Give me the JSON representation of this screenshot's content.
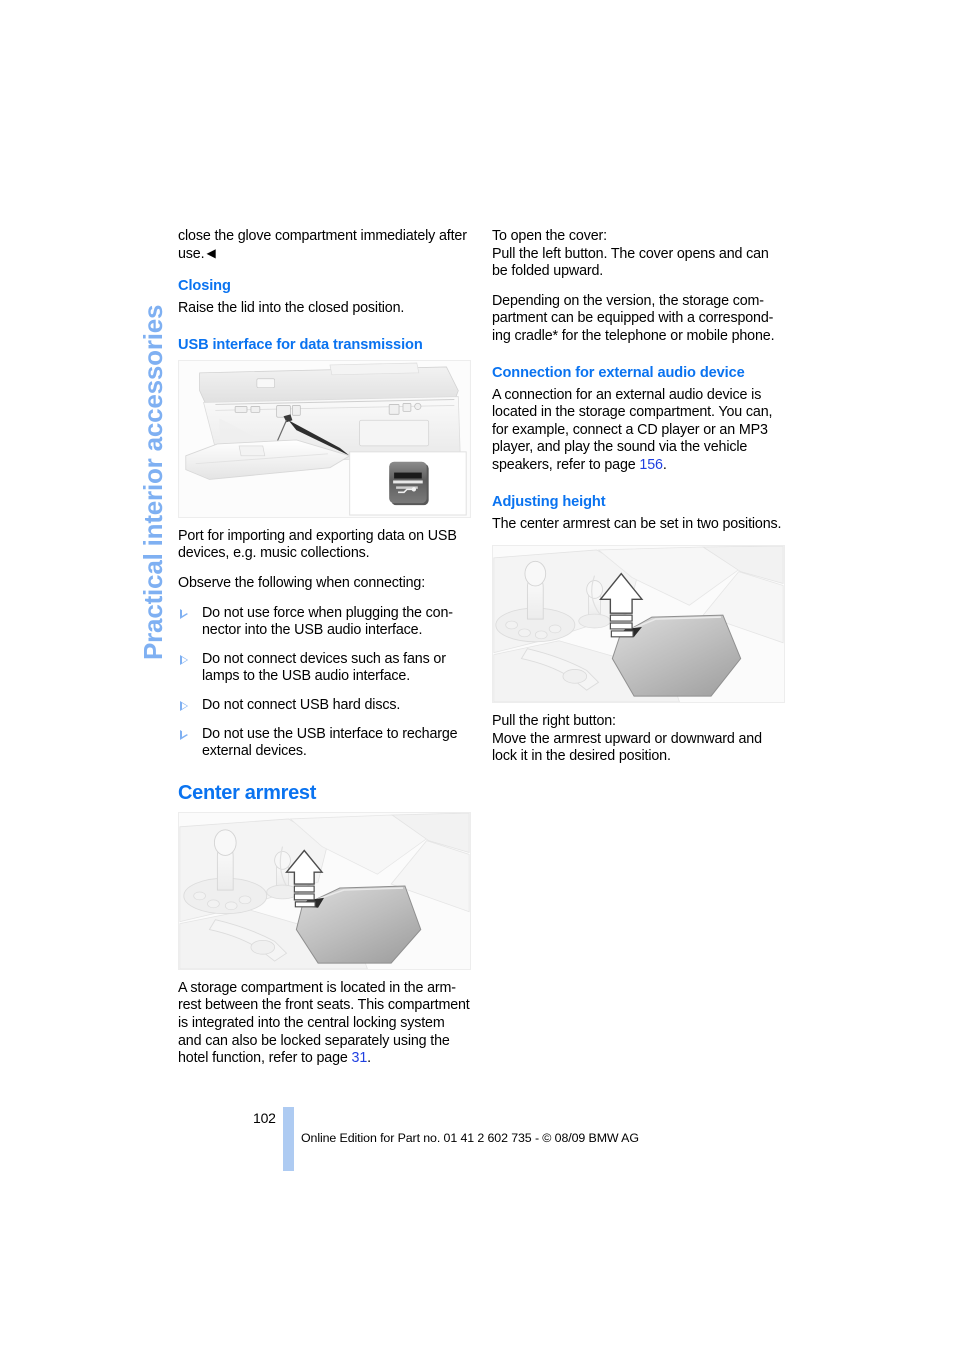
{
  "chapter_tab": {
    "label": "Practical interior accessories",
    "color": "#7fb0f2"
  },
  "theme": {
    "heading_blue": "#0a73f0",
    "link_blue": "#1f3fe0",
    "tab_blue": "#7fb0f2",
    "folio_bar_blue": "#aecbf2"
  },
  "left_column": {
    "intro_paragraph": "close the glove compartment immediately after use.",
    "intro_end_mark": "◀",
    "closing_heading": "Closing",
    "closing_text": "Raise the lid into the closed position.",
    "usb_heading": "USB interface for data transmission",
    "usb_figure_name": "glove-compartment-usb-port-illustration",
    "usb_inset_name": "usb-socket-closeup-inset",
    "usb_port_text": "Port for importing and exporting data on USB devices, e.g. music collections.",
    "usb_observe_text": "Observe the following when connecting:",
    "usb_bullets": [
      "Do not use force when plugging the con-nector into the USB audio interface.",
      "Do not connect devices such as fans or lamps to the USB audio interface.",
      "Do not connect USB hard discs.",
      "Do not use the USB interface to recharge external devices."
    ],
    "center_armrest_heading": "Center armrest",
    "armrest_figure_name": "center-armrest-illustration",
    "armrest_paragraph_before_link": "A storage compartment is located in the arm-rest between the front seats. This compartment is integrated into the central locking system and can also be locked separately using the hotel function, refer to page ",
    "armrest_page_ref": "31",
    "armrest_paragraph_after_link": "."
  },
  "right_column": {
    "open_cover_line1": "To open the cover:",
    "open_cover_line2": "Pull the left button. The cover opens and can be folded upward.",
    "version_paragraph": "Depending on the version, the storage com-partment can be equipped with a correspond-ing cradle* for the telephone or mobile phone.",
    "audio_heading": "Connection for external audio device",
    "audio_text_before_link": "A connection for an external audio device is located in the storage compartment. You can, for example, connect a CD player or an MP3 player, and play the sound via the vehicle speakers, refer to page ",
    "audio_page_ref": "156",
    "audio_text_after_link": ".",
    "height_heading": "Adjusting height",
    "height_text": "The center armrest can be set in two positions.",
    "armrest_figure_name": "armrest-height-adjustment-illustration",
    "pull_line1": "Pull the right button:",
    "pull_line2": "Move the armrest upward or downward and lock it in the desired position."
  },
  "footer": {
    "page_number": "102",
    "imprint": "Online Edition for Part no. 01 41 2 602 735 - © 08/09 BMW AG"
  }
}
